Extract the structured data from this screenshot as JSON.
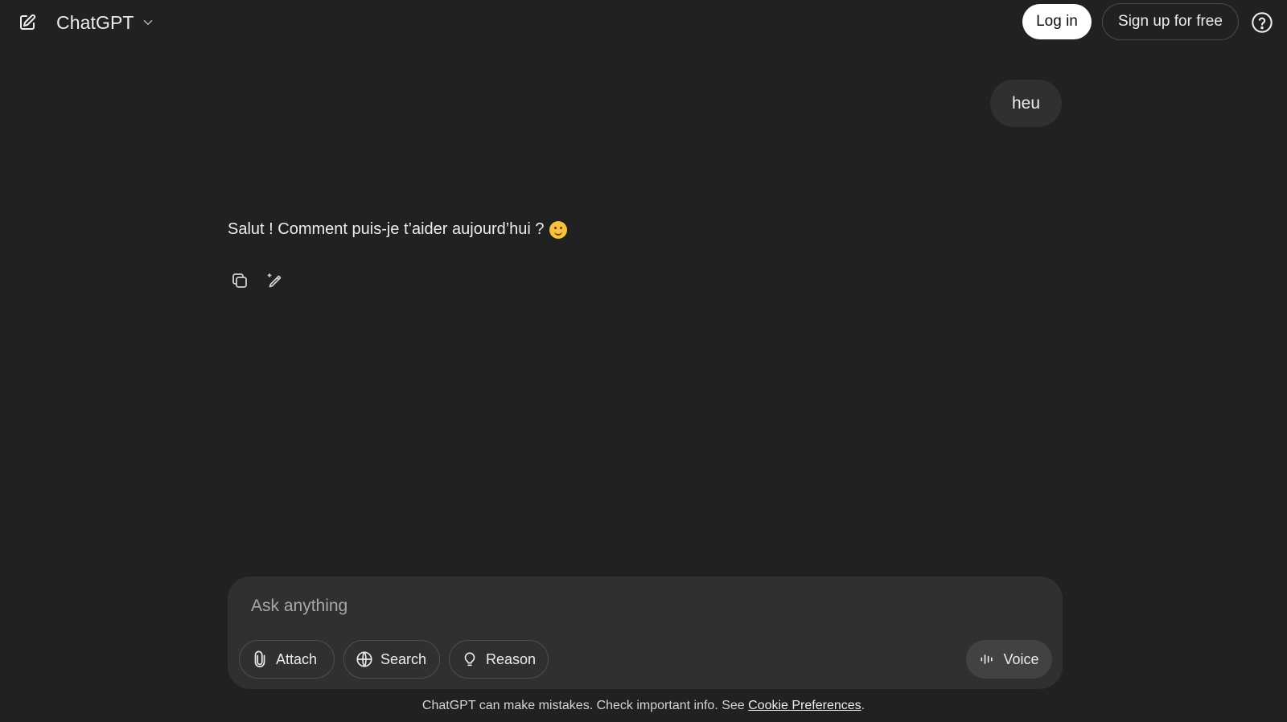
{
  "header": {
    "model_name": "ChatGPT",
    "login_label": "Log in",
    "signup_label": "Sign up for free"
  },
  "conversation": {
    "user_message": "heu",
    "assistant_message": "Salut ! Comment puis-je t’aider aujourd’hui ?"
  },
  "composer": {
    "placeholder": "Ask anything",
    "attach_label": "Attach",
    "search_label": "Search",
    "reason_label": "Reason",
    "voice_label": "Voice"
  },
  "footer": {
    "note_text": "ChatGPT can make mistakes. Check important info. See ",
    "link_label": "Cookie Preferences",
    "note_end": "."
  },
  "icons": {
    "new_chat": "edit-square-icon",
    "model_dropdown": "chevron-down-icon",
    "help": "help-circle-icon",
    "copy": "copy-icon",
    "edit_response": "magic-pencil-icon",
    "attach": "paperclip-icon",
    "search": "globe-icon",
    "reason": "lightbulb-icon",
    "voice": "waveform-icon",
    "emoji": "smiling-face-emoji"
  },
  "colors": {
    "background": "#212121",
    "surface": "#303030",
    "text": "#ececec",
    "login_bg": "#ffffff"
  }
}
